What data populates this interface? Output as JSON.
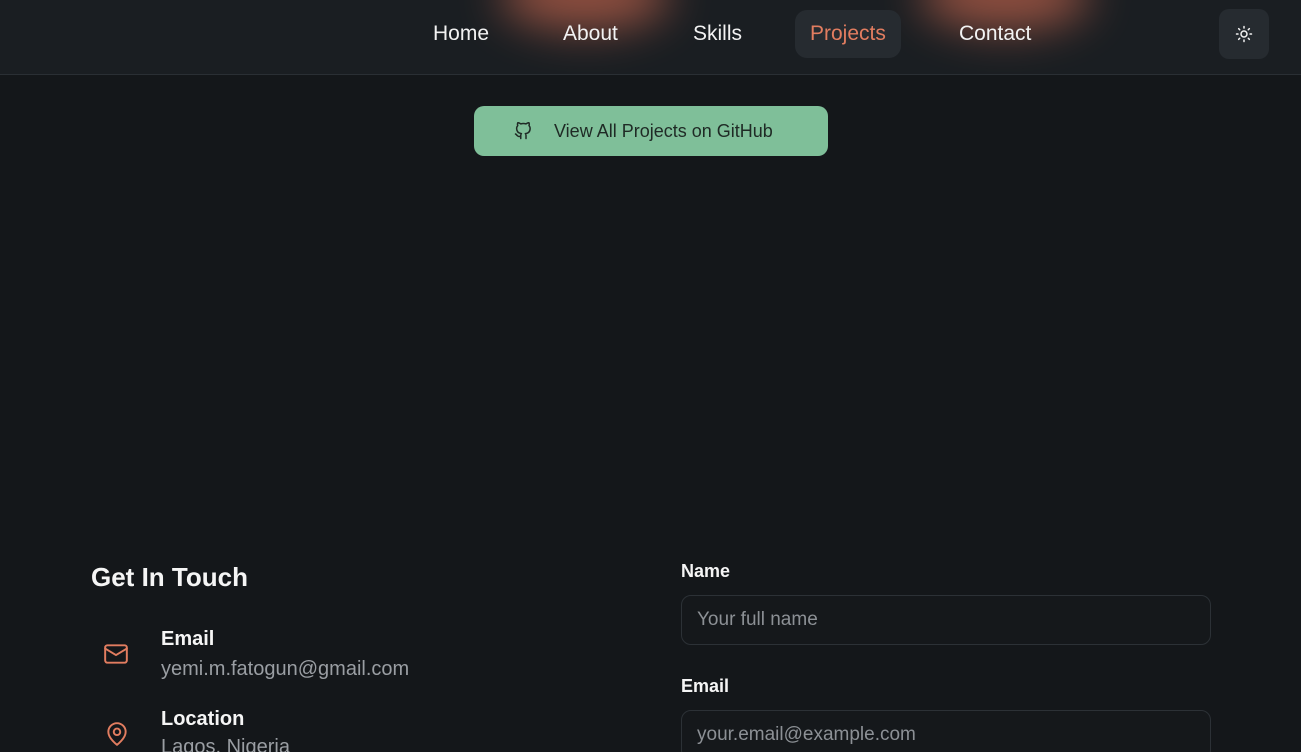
{
  "nav": {
    "items": [
      {
        "label": "Home"
      },
      {
        "label": "About"
      },
      {
        "label": "Skills"
      },
      {
        "label": "Projects",
        "active": true
      },
      {
        "label": "Contact"
      }
    ],
    "theme_toggle_icon": "sun-icon"
  },
  "github_button": {
    "label": "View All Projects on GitHub",
    "icon": "github-icon"
  },
  "contact": {
    "title": "Get In Touch",
    "email_label": "Email",
    "email_value": "yemi.m.fatogun@gmail.com",
    "location_label": "Location",
    "location_value": "Lagos, Nigeria"
  },
  "form": {
    "name_label": "Name",
    "name_placeholder": "Your full name",
    "email_label": "Email",
    "email_placeholder": "your.email@example.com"
  },
  "colors": {
    "accent": "#e27d60",
    "button_green": "#7fbf99",
    "background": "#14171a"
  }
}
